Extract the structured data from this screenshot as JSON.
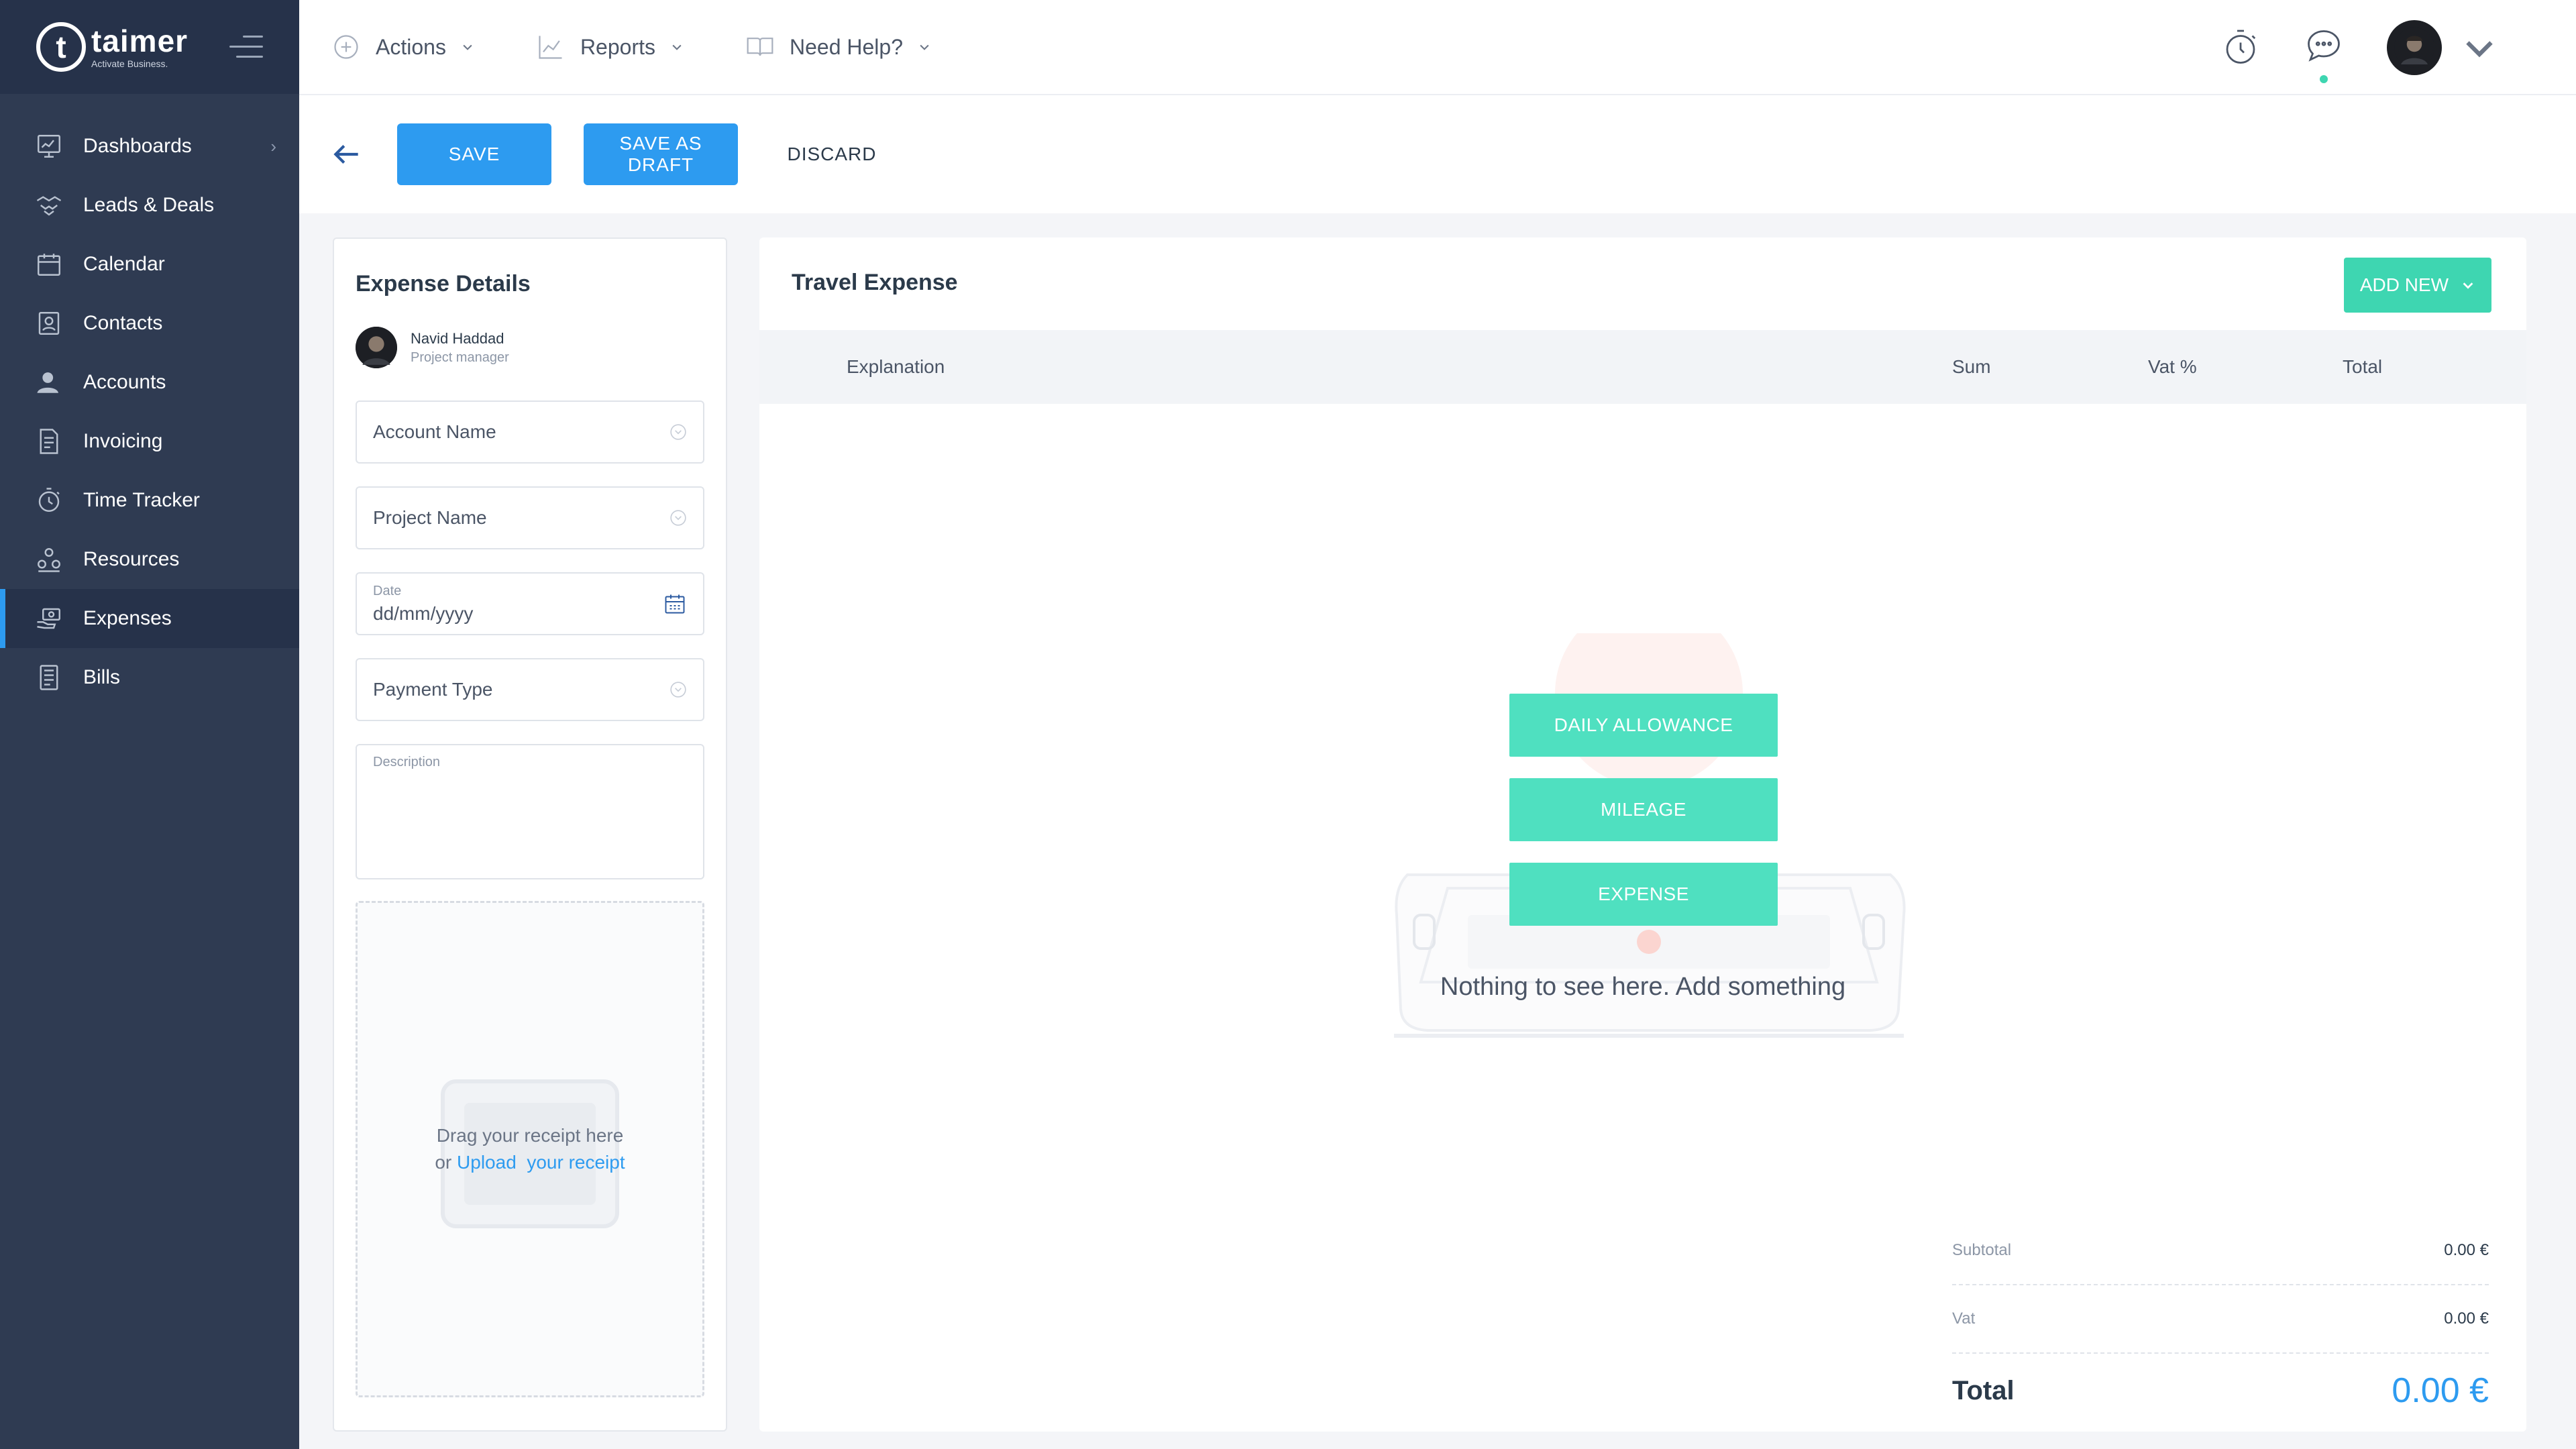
{
  "app": {
    "logo_name": "taimer",
    "logo_tagline": "Activate Business.",
    "logo_glyph": "t"
  },
  "sidebar": {
    "items": [
      {
        "label": "Dashboards",
        "icon": "dashboard-icon"
      },
      {
        "label": "Leads & Deals",
        "icon": "handshake-icon"
      },
      {
        "label": "Calendar",
        "icon": "calendar-icon"
      },
      {
        "label": "Contacts",
        "icon": "contact-card-icon"
      },
      {
        "label": "Accounts",
        "icon": "user-icon"
      },
      {
        "label": "Invoicing",
        "icon": "invoice-icon"
      },
      {
        "label": "Time Tracker",
        "icon": "stopwatch-icon"
      },
      {
        "label": "Resources",
        "icon": "resources-icon"
      },
      {
        "label": "Expenses",
        "icon": "expense-hand-icon"
      },
      {
        "label": "Bills",
        "icon": "bill-icon"
      }
    ],
    "active_item": "Expenses"
  },
  "topbar": {
    "actions_label": "Actions",
    "reports_label": "Reports",
    "help_label": "Need Help?"
  },
  "toolbar": {
    "save_label": "SAVE",
    "save_draft_label": "SAVE AS DRAFT",
    "discard_label": "DISCARD"
  },
  "expense_details": {
    "title": "Expense Details",
    "person_name": "Navid Haddad",
    "person_role": "Project manager",
    "account_placeholder": "Account Name",
    "project_placeholder": "Project Name",
    "date_label": "Date",
    "date_placeholder": "dd/mm/yyyy",
    "payment_placeholder": "Payment Type",
    "description_label": "Description",
    "dropzone_line1": "Drag your receipt here",
    "dropzone_or": "or ",
    "dropzone_upload": "Upload",
    "dropzone_receipt": "your receipt"
  },
  "travel_expense": {
    "title": "Travel Expense",
    "add_new_label": "ADD NEW",
    "columns": [
      "Explanation",
      "Sum",
      "Vat %",
      "Total"
    ],
    "options": [
      "DAILY ALLOWANCE",
      "MILEAGE",
      "EXPENSE"
    ],
    "empty_text": "Nothing to see here. Add something",
    "subtotal_label": "Subtotal",
    "subtotal_value": "0.00 €",
    "vat_label": "Vat",
    "vat_value": "0.00 €",
    "total_label": "Total",
    "total_value": "0.00 €"
  },
  "colors": {
    "sidebar_bg": "#2f3b52",
    "sidebar_top_bg": "#26324a",
    "primary_blue": "#2d9bf0",
    "accent_teal": "#3ed6b1"
  }
}
